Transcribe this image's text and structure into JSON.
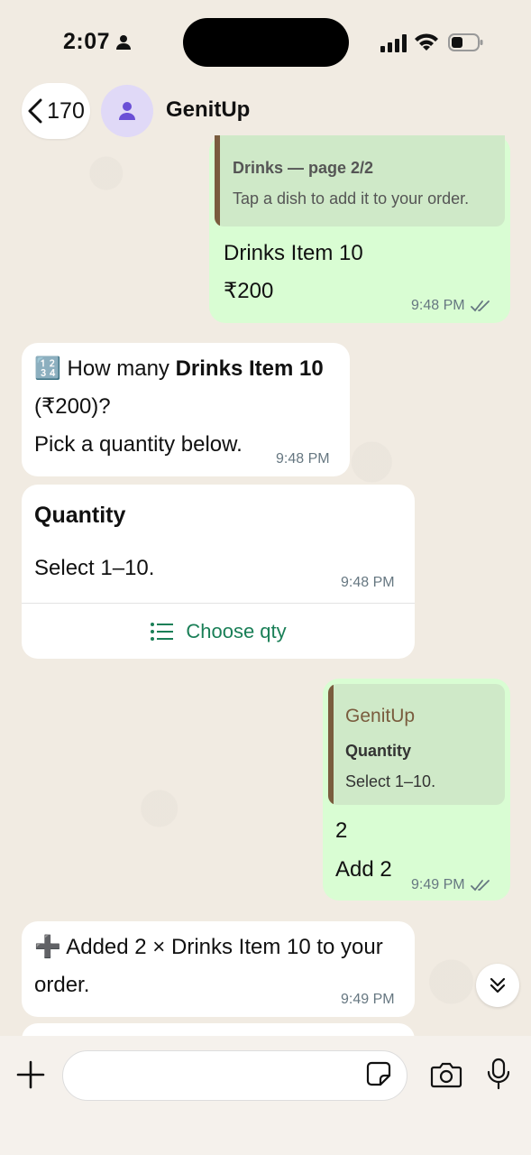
{
  "status_bar": {
    "time": "2:07"
  },
  "header": {
    "back_count": "170",
    "contact_name": "GenitUp"
  },
  "messages": {
    "m1": {
      "quote_title": "Drinks — page 2/2",
      "quote_body": "Tap a dish to add it to your order.",
      "line1": "Drinks Item 10",
      "line2": "₹200",
      "time": "9:48 PM"
    },
    "m2": {
      "emoji": "🔢",
      "prefix": " How many ",
      "bold": "Drinks Item 10",
      "line2": "(₹200)?",
      "line3": "Pick a quantity below.",
      "time": "9:48 PM"
    },
    "m3": {
      "title": "Quantity",
      "body": "Select 1–10.",
      "time": "9:48 PM",
      "action_label": "Choose qty"
    },
    "m4": {
      "quote_sender": "GenitUp",
      "quote_title": "Quantity",
      "quote_body": "Select 1–10.",
      "line1": "2",
      "line2": "Add 2",
      "time": "9:49 PM"
    },
    "m5": {
      "line1": "➕ Added 2 × Drinks Item 10 to your",
      "line2": "order.",
      "time": "9:49 PM"
    }
  },
  "colors": {
    "outgoing": "#d9fdd3",
    "incoming": "#ffffff",
    "accent_green": "#1a7f57",
    "quote_bar": "#7a5c3e"
  }
}
